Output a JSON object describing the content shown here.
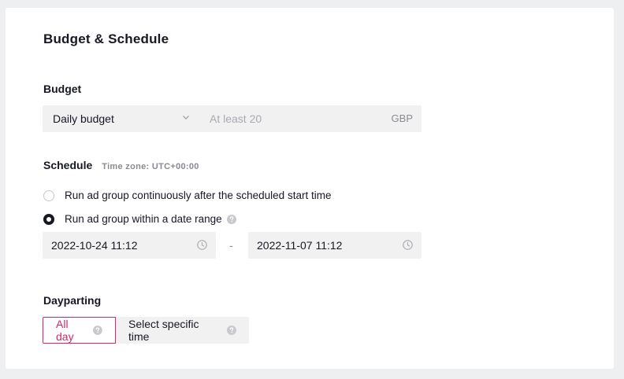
{
  "page_title": "Budget & Schedule",
  "budget": {
    "label": "Budget",
    "type_value": "Daily budget",
    "amount_placeholder": "At least 20",
    "amount_value": "",
    "currency": "GBP"
  },
  "schedule": {
    "label": "Schedule",
    "timezone": "Time zone: UTC+00:00",
    "options": [
      {
        "label": "Run ad group continuously after the scheduled start time",
        "checked": false
      },
      {
        "label": "Run ad group within a date range",
        "checked": true
      }
    ],
    "start": "2022-10-24 11:12",
    "separator": "-",
    "end": "2022-11-07 11:12"
  },
  "dayparting": {
    "label": "Dayparting",
    "options": [
      {
        "label": "All day",
        "selected": true
      },
      {
        "label": "Select specific time",
        "selected": false
      }
    ]
  },
  "colors": {
    "accent": "#d4266e",
    "field_bg": "#f1f1f2",
    "muted": "#8a8b91"
  },
  "icons": {
    "dropdown": "chevron-down-icon",
    "help": "question-circle-icon",
    "time": "clock-icon"
  }
}
